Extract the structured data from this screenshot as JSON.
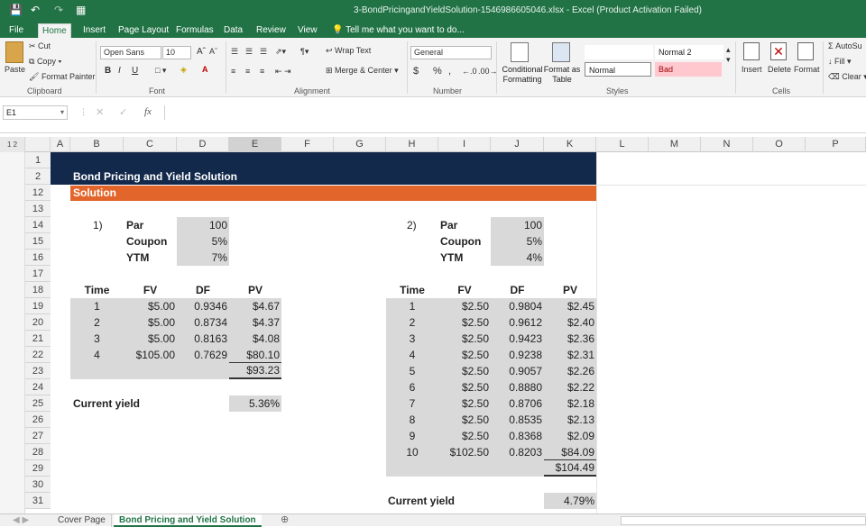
{
  "window": {
    "title": "3-BondPricingandYieldSolution-1546986605046.xlsx - Excel (Product Activation Failed)"
  },
  "ribbon_tabs": [
    "File",
    "Home",
    "Insert",
    "Page Layout",
    "Formulas",
    "Data",
    "Review",
    "View"
  ],
  "tell_me": "Tell me what you want to do...",
  "clipboard": {
    "paste": "Paste",
    "cut": "Cut",
    "copy": "Copy",
    "format_painter": "Format Painter",
    "label": "Clipboard"
  },
  "font": {
    "name": "Open Sans",
    "size": "10",
    "bold": "B",
    "italic": "I",
    "underline": "U",
    "label": "Font"
  },
  "alignment": {
    "wrap": "Wrap Text",
    "merge": "Merge & Center",
    "label": "Alignment"
  },
  "number": {
    "format": "General",
    "currency": "$",
    "percent": "%",
    "comma": ",",
    "label": "Number"
  },
  "styles": {
    "conditional": "Conditional Formatting",
    "format_as": "Format as Table",
    "normal2": "Normal 2",
    "normal": "Normal",
    "bad": "Bad",
    "label": "Styles"
  },
  "cells": {
    "insert": "Insert",
    "delete": "Delete",
    "format": "Format",
    "label": "Cells"
  },
  "editing": {
    "autosum": "AutoSu",
    "fill": "Fill",
    "clear": "Clear"
  },
  "namebox": "E1",
  "fx_symbol": "fx",
  "columns": [
    "A",
    "B",
    "C",
    "D",
    "E",
    "F",
    "G",
    "H",
    "I",
    "J",
    "K",
    "L",
    "M",
    "N",
    "O",
    "P"
  ],
  "rows": [
    "1",
    "2",
    "12",
    "13",
    "14",
    "15",
    "16",
    "17",
    "18",
    "19",
    "20",
    "21",
    "22",
    "23",
    "24",
    "25",
    "26",
    "27",
    "28",
    "29",
    "30",
    "31"
  ],
  "sheet": {
    "header_title": "Bond Pricing and Yield Solution",
    "sub_title": "Solution",
    "p1": {
      "num": "1)",
      "par_label": "Par",
      "par": "100",
      "coupon_label": "Coupon",
      "coupon": "5%",
      "ytm_label": "YTM",
      "ytm": "7%",
      "headers": [
        "Time",
        "FV",
        "DF",
        "PV"
      ],
      "rows": [
        [
          "1",
          "$5.00",
          "0.9346",
          "$4.67"
        ],
        [
          "2",
          "$5.00",
          "0.8734",
          "$4.37"
        ],
        [
          "3",
          "$5.00",
          "0.8163",
          "$4.08"
        ],
        [
          "4",
          "$105.00",
          "0.7629",
          "$80.10"
        ]
      ],
      "total": "$93.23",
      "cy_label": "Current yield",
      "cy": "5.36%"
    },
    "p2": {
      "num": "2)",
      "par_label": "Par",
      "par": "100",
      "coupon_label": "Coupon",
      "coupon": "5%",
      "ytm_label": "YTM",
      "ytm": "4%",
      "headers": [
        "Time",
        "FV",
        "DF",
        "PV"
      ],
      "rows": [
        [
          "1",
          "$2.50",
          "0.9804",
          "$2.45"
        ],
        [
          "2",
          "$2.50",
          "0.9612",
          "$2.40"
        ],
        [
          "3",
          "$2.50",
          "0.9423",
          "$2.36"
        ],
        [
          "4",
          "$2.50",
          "0.9238",
          "$2.31"
        ],
        [
          "5",
          "$2.50",
          "0.9057",
          "$2.26"
        ],
        [
          "6",
          "$2.50",
          "0.8880",
          "$2.22"
        ],
        [
          "7",
          "$2.50",
          "0.8706",
          "$2.18"
        ],
        [
          "8",
          "$2.50",
          "0.8535",
          "$2.13"
        ],
        [
          "9",
          "$2.50",
          "0.8368",
          "$2.09"
        ],
        [
          "10",
          "$102.50",
          "0.8203",
          "$84.09"
        ]
      ],
      "total": "$104.49",
      "cy_label": "Current yield",
      "cy": "4.79%"
    }
  },
  "sheet_tabs": [
    "Cover Page",
    "Bond Pricing and Yield Solution"
  ],
  "colors": {
    "excel_green": "#217346",
    "header_navy": "#13294b",
    "solution_orange": "#e2662b",
    "shade": "#d9d9d9"
  }
}
